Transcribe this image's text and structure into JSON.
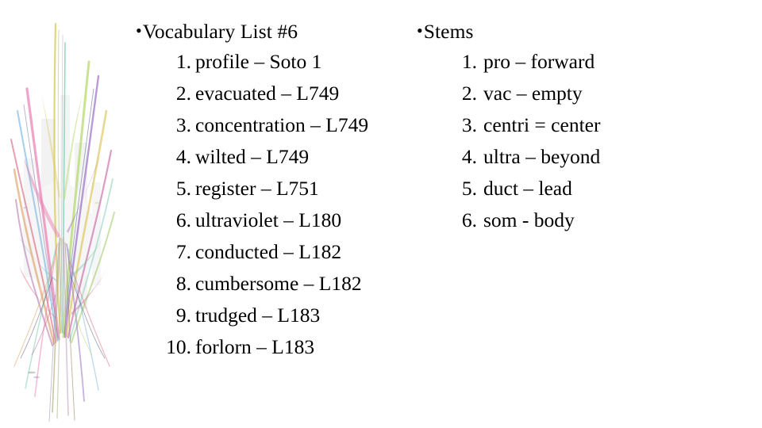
{
  "slide": {
    "background_color": "#ffffff",
    "text_color": "#000000",
    "bullet_glyph": "•"
  },
  "artwork": {
    "name": "abstract-feather-spray-decoration",
    "description": "Pastel multicolored fanning brush strokes over faint gray vertical bands",
    "palette": [
      "#e87fb4",
      "#c45ea0",
      "#9b6fc4",
      "#7fb8e0",
      "#6fc8a8",
      "#b8d870",
      "#e0c860",
      "#e09a5a",
      "#d8607a",
      "#cccccc",
      "#9a9a9a"
    ],
    "band_color": "#e8e8e8"
  },
  "columns": {
    "vocabulary": {
      "heading": "Vocabulary List #6",
      "items": [
        {
          "number": "1.",
          "text": "profile – Soto 1"
        },
        {
          "number": "2.",
          "text": "evacuated – L749"
        },
        {
          "number": "3.",
          "text": "concentration – L749"
        },
        {
          "number": "4.",
          "text": "wilted – L749"
        },
        {
          "number": "5.",
          "text": "register – L751"
        },
        {
          "number": "6.",
          "text": "ultraviolet – L180"
        },
        {
          "number": "7.",
          "text": "conducted – L182"
        },
        {
          "number": "8.",
          "text": "cumbersome – L182"
        },
        {
          "number": "9.",
          "text": "trudged – L183"
        },
        {
          "number": "10.",
          "text": "forlorn – L183"
        }
      ]
    },
    "stems": {
      "heading": "Stems",
      "items": [
        {
          "number": "1.",
          "text": "pro – forward"
        },
        {
          "number": "2.",
          "text": "vac – empty"
        },
        {
          "number": "3.",
          "text": "centri = center"
        },
        {
          "number": "4.",
          "text": "ultra – beyond"
        },
        {
          "number": "5.",
          "text": "duct – lead"
        },
        {
          "number": "6.",
          "text": "som - body"
        }
      ]
    }
  }
}
